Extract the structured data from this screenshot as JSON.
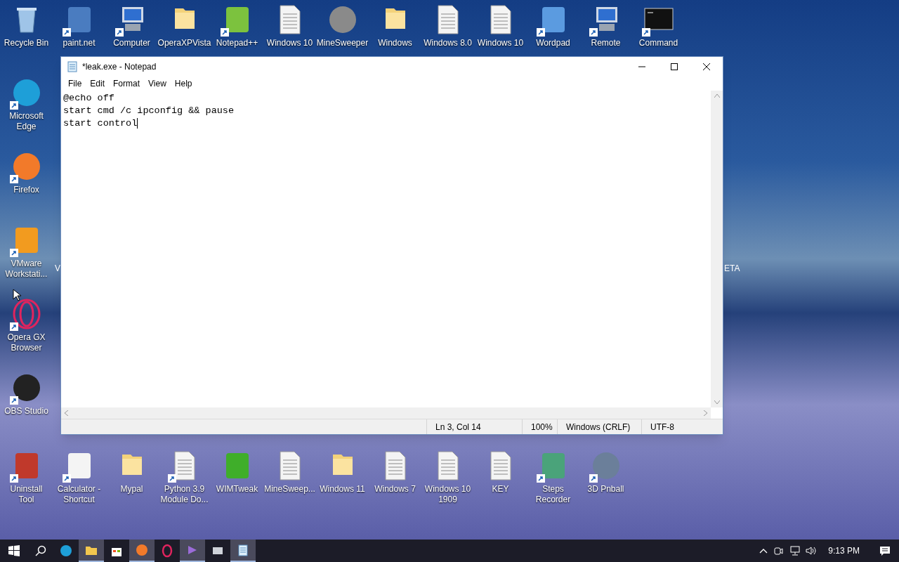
{
  "desktop": {
    "top_row": [
      {
        "label": "Recycle Bin",
        "kind": "recycle",
        "color": "#9fc4e8",
        "shortcut": false
      },
      {
        "label": "paint.net",
        "kind": "app",
        "color": "#4a7cc0",
        "shortcut": true
      },
      {
        "label": "Computer",
        "kind": "computer",
        "color": "#2f6fd0",
        "shortcut": true
      },
      {
        "label": "OperaXPVista",
        "kind": "folder",
        "color": "#f3d27a",
        "shortcut": false
      },
      {
        "label": "Notepad++",
        "kind": "app",
        "color": "#7cc23e",
        "shortcut": true
      },
      {
        "label": "Windows 10",
        "kind": "document",
        "color": "#f4f4f4",
        "shortcut": false
      },
      {
        "label": "MineSweeper",
        "kind": "round",
        "color": "#8a8a8a",
        "shortcut": false
      },
      {
        "label": "Windows",
        "kind": "folder",
        "color": "#f3d27a",
        "shortcut": false
      },
      {
        "label": "Windows 8.0",
        "kind": "document",
        "color": "#f4f4f4",
        "shortcut": false
      },
      {
        "label": "Windows 10",
        "kind": "document",
        "color": "#f4f4f4",
        "shortcut": false
      },
      {
        "label": "Wordpad",
        "kind": "app",
        "color": "#5b9be0",
        "shortcut": true
      },
      {
        "label": "Remote",
        "kind": "computer",
        "color": "#2f6fd0",
        "shortcut": true
      },
      {
        "label": "Command",
        "kind": "terminal",
        "color": "#111111",
        "shortcut": true
      }
    ],
    "left_column": [
      {
        "label": "Microsoft Edge",
        "kind": "round",
        "color": "#1e9fd8",
        "shortcut": true
      },
      {
        "label": "Firefox",
        "kind": "round",
        "color": "#f27a2a",
        "shortcut": true
      },
      {
        "label": "VMware Workstati...",
        "kind": "app",
        "color": "#f29b1f",
        "shortcut": true
      },
      {
        "label": "Opera GX Browser",
        "kind": "ring",
        "color": "#e0245e",
        "shortcut": true
      },
      {
        "label": "OBS Studio",
        "kind": "round",
        "color": "#222222",
        "shortcut": true
      }
    ],
    "bottom_row": [
      {
        "label": "Uninstall Tool",
        "kind": "app",
        "color": "#c0392b",
        "shortcut": true
      },
      {
        "label": "Calculator - Shortcut",
        "kind": "app",
        "color": "#f4f4f4",
        "shortcut": true
      },
      {
        "label": "Mypal",
        "kind": "folder",
        "color": "#f3d27a",
        "shortcut": false
      },
      {
        "label": "Python 3.9 Module Do...",
        "kind": "document",
        "color": "#f4f4f4",
        "shortcut": true
      },
      {
        "label": "WIMTweak",
        "kind": "app",
        "color": "#3fae2a",
        "shortcut": false
      },
      {
        "label": "MineSweep...",
        "kind": "document",
        "color": "#f4f4f4",
        "shortcut": false
      },
      {
        "label": "Windows 11",
        "kind": "folder",
        "color": "#f3d27a",
        "shortcut": false
      },
      {
        "label": "Windows 7",
        "kind": "document",
        "color": "#f4f4f4",
        "shortcut": false
      },
      {
        "label": "Windows 10 1909",
        "kind": "document",
        "color": "#f4f4f4",
        "shortcut": false
      },
      {
        "label": "KEY",
        "kind": "document",
        "color": "#f4f4f4",
        "shortcut": false
      },
      {
        "label": "Steps Recorder",
        "kind": "app",
        "color": "#4aa37a",
        "shortcut": true
      },
      {
        "label": "3D Pnball",
        "kind": "round",
        "color": "#6b7f9a",
        "shortcut": true
      }
    ],
    "label_fragments": [
      "V",
      "ETA"
    ]
  },
  "notepad": {
    "title": "*leak.exe - Notepad",
    "menu": [
      "File",
      "Edit",
      "Format",
      "View",
      "Help"
    ],
    "lines": [
      "@echo off",
      "start cmd /c ipconfig && pause",
      "start control"
    ],
    "status": [
      "Ln 3, Col 14",
      "100%",
      "Windows (CRLF)",
      "UTF-8"
    ]
  },
  "taskbar": {
    "apps": [
      {
        "kind": "edge",
        "active": false
      },
      {
        "kind": "explorer",
        "active": true
      },
      {
        "kind": "store",
        "active": false
      },
      {
        "kind": "firefox",
        "active": true
      },
      {
        "kind": "opera",
        "active": false
      },
      {
        "kind": "studio",
        "active": true
      },
      {
        "kind": "tool",
        "active": false
      },
      {
        "kind": "notepad",
        "active": true
      }
    ],
    "time": "9:13 PM"
  }
}
